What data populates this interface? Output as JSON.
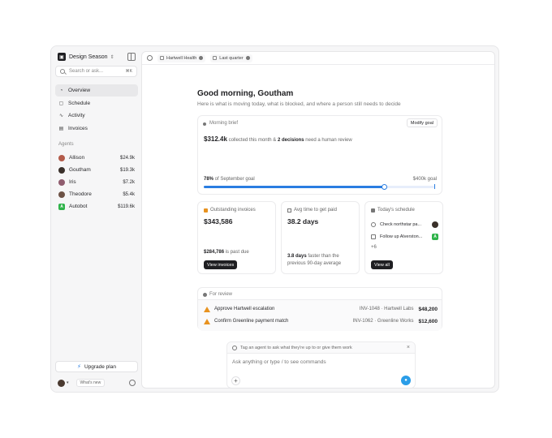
{
  "workspace": {
    "logo_icon": "workspace-logo-icon",
    "name": "Design Season",
    "switch_icon": "chevron-updown-icon"
  },
  "search": {
    "placeholder": "Search or ask...",
    "shortcut": "⌘K"
  },
  "nav": [
    {
      "label": "Overview",
      "icon": "overview-icon",
      "active": true
    },
    {
      "label": "Schedule",
      "icon": "schedule-icon",
      "active": false
    },
    {
      "label": "Activity",
      "icon": "activity-icon",
      "active": false
    },
    {
      "label": "Invoices",
      "icon": "invoices-icon",
      "active": false
    }
  ],
  "agents_heading": "Agents",
  "agents": [
    {
      "name": "Allison",
      "amount": "$24.9k",
      "color": "#b35b4a"
    },
    {
      "name": "Goutham",
      "amount": "$19.3k",
      "color": "#3a302a"
    },
    {
      "name": "Iris",
      "amount": "$7.2k",
      "color": "#8f5c6e"
    },
    {
      "name": "Theodore",
      "amount": "$5.4k",
      "color": "#6d5246"
    },
    {
      "name": "Autobot",
      "amount": "$119.6k",
      "color": "#2fb34a",
      "glyph": "A"
    }
  ],
  "upgrade": {
    "label": "Upgrade plan",
    "icon": "lightning-icon"
  },
  "footer": {
    "whats_new": "What's new"
  },
  "topbar": {
    "chips": [
      {
        "label": "Hartwell Health"
      },
      {
        "label": "Last quarter"
      }
    ]
  },
  "greeting": {
    "title": "Good morning, Goutham",
    "subtitle": "Here is what is moving today, what is blocked, and where a person still needs to decide"
  },
  "brief": {
    "title": "Morning brief",
    "modify": "Modify goal",
    "amount": "$312.4k",
    "text_mid": " collected this month & ",
    "decisions": "2 decisions",
    "text_end": " need a human review",
    "goal_pct": "78%",
    "goal_label": " of September goal",
    "goal_target": "$400k goal",
    "progress": 0.78
  },
  "cards": {
    "invoices": {
      "title": "Outstanding invoices",
      "amount": "$343,586",
      "note_amount": "$284,786",
      "note_text": " is past due",
      "button": "View invoices"
    },
    "paid": {
      "title": "Avg time to get paid",
      "value": "38.2 days",
      "note_bold": "3.8 days",
      "note_text": " faster than the previous 90-day average"
    },
    "schedule": {
      "title": "Today's schedule",
      "items": [
        {
          "label": "Check northstar pa...",
          "icon": "clock-icon",
          "avatar_color": "#3a302a"
        },
        {
          "label": "Follow up Alverston...",
          "icon": "mail-icon",
          "avatar_color": "#2fb34a",
          "glyph": "A"
        }
      ],
      "more": "+6",
      "button": "View all"
    }
  },
  "review": {
    "title": "For review",
    "rows": [
      {
        "label": "Approve Hartwell escalation",
        "ref": "INV-1048 · Hartwell Labs",
        "amount": "$48,200"
      },
      {
        "label": "Confirm Greenline payment match",
        "ref": "INV-1062 · Greenline Works",
        "amount": "$12,600"
      }
    ]
  },
  "composer": {
    "hint": "Tag an agent to ask what they're up to or give them work",
    "placeholder": "Ask anything or type / to see commands"
  }
}
